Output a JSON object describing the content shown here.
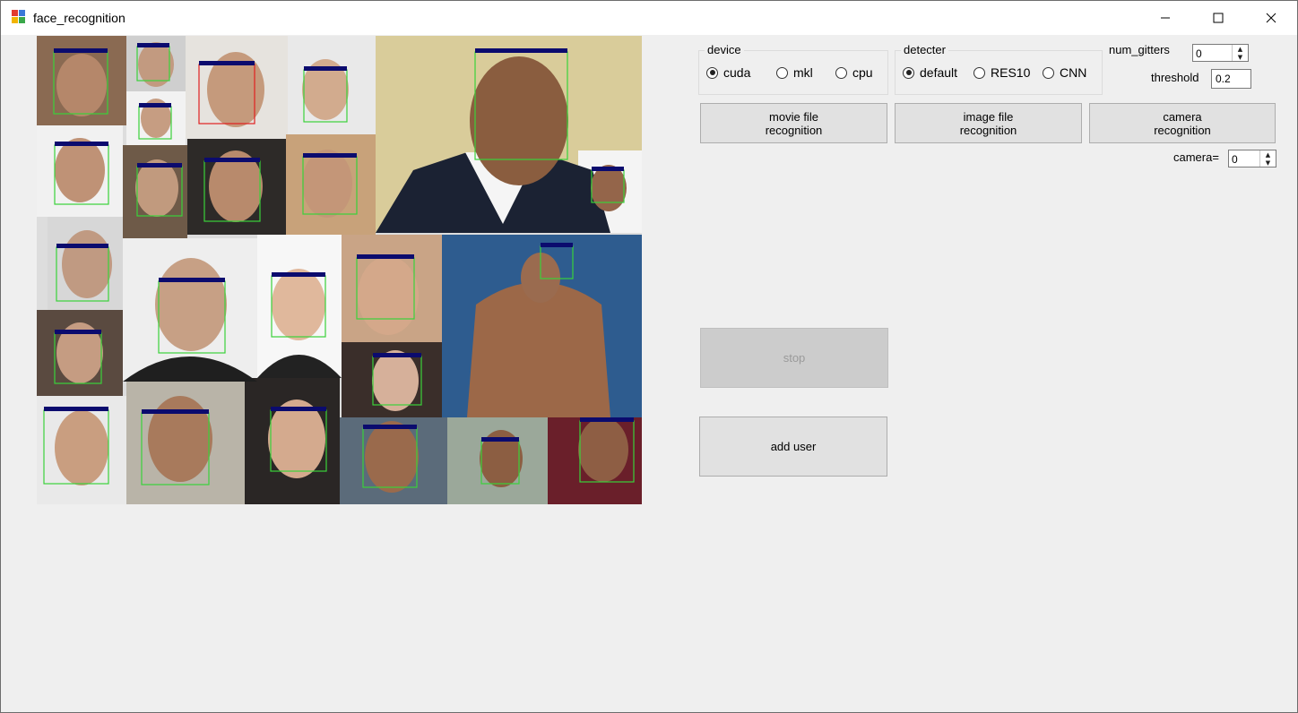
{
  "window": {
    "title": "face_recognition"
  },
  "titlebar_buttons": {
    "minimize": "─",
    "maximize": "☐",
    "close": "✕"
  },
  "device": {
    "label": "device",
    "options": [
      "cuda",
      "mkl",
      "cpu"
    ],
    "selected": "cuda"
  },
  "detecter": {
    "label": "detecter",
    "options": [
      "default",
      "RES10",
      "CNN"
    ],
    "selected": "default"
  },
  "num_gitters": {
    "label": "num_gitters",
    "value": "0"
  },
  "threshold": {
    "label": "threshold",
    "value": "0.2"
  },
  "buttons": {
    "movie": "movie file\nrecognition",
    "image": "image file\nrecognition",
    "camera": "camera\nrecognition",
    "stop": "stop",
    "add_user": "add user"
  },
  "camera": {
    "label": "camera=",
    "value": "0"
  },
  "colors": {
    "face_box": "#3ad23a",
    "label_bar": "#0b0b6e",
    "unknown_box": "#e02020"
  }
}
